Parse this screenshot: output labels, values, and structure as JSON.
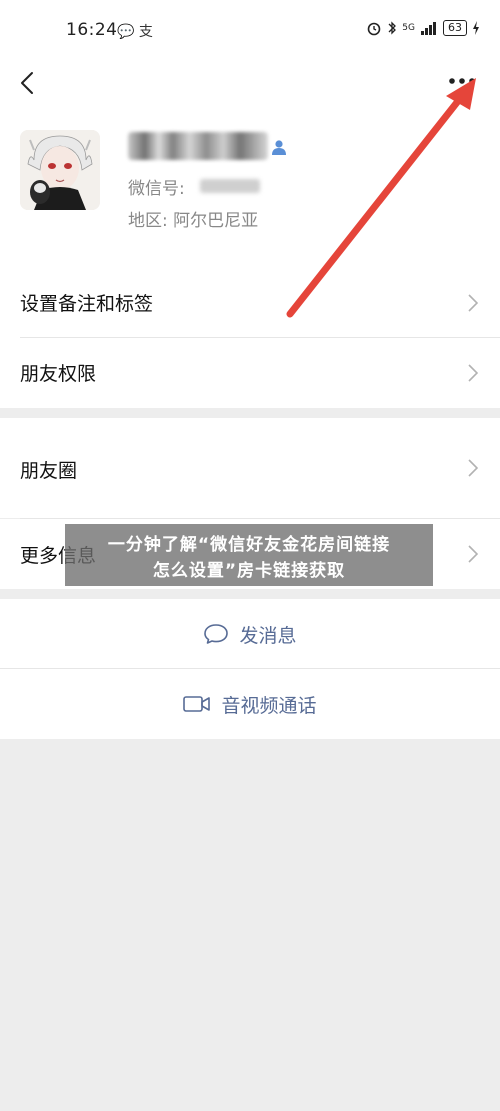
{
  "status_bar": {
    "time": "16:24",
    "app_icons": "💬 支",
    "battery": "63",
    "network": "5G"
  },
  "header": {
    "back_icon": "chevron-left-icon",
    "more_icon": "more-dots-icon"
  },
  "profile": {
    "wechat_id_label": "微信号:",
    "region": "地区: 阿尔巴尼亚"
  },
  "menu": {
    "remark_tags": "设置备注和标签",
    "friend_permissions": "朋友权限",
    "moments": "朋友圈",
    "more_info": "更多信息"
  },
  "actions": {
    "send_message": "发消息",
    "video_call": "音视频通话"
  },
  "watermark": {
    "line1": "一分钟了解“微信好友金花房间链接",
    "line2": "怎么设置”房卡链接获取"
  },
  "colors": {
    "arrow": "#e5453a",
    "link": "#576b95",
    "background": "#ededed"
  }
}
